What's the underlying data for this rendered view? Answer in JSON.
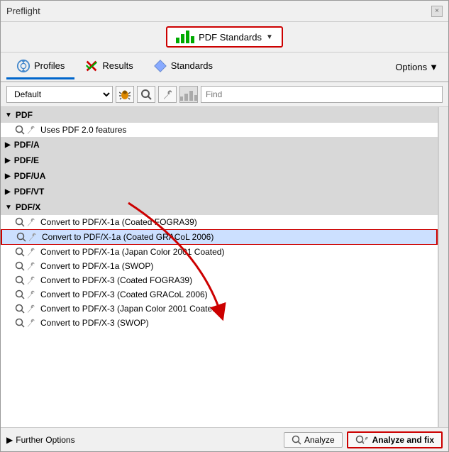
{
  "window": {
    "title": "Preflight",
    "close_label": "×"
  },
  "toolbar": {
    "pdf_standards_label": "PDF Standards",
    "dropdown_arrow": "▼"
  },
  "tabs": {
    "profiles_label": "Profiles",
    "results_label": "Results",
    "standards_label": "Standards",
    "options_label": "Options",
    "options_arrow": "▼"
  },
  "controls": {
    "dropdown_default": "Default",
    "find_placeholder": "Find"
  },
  "tree": {
    "groups": [
      {
        "id": "pdf",
        "label": "PDF",
        "expanded": true,
        "items": [
          {
            "label": "Uses PDF 2.0 features"
          }
        ]
      },
      {
        "id": "pdfa",
        "label": "PDF/A",
        "expanded": false,
        "items": []
      },
      {
        "id": "pdfe",
        "label": "PDF/E",
        "expanded": false,
        "items": []
      },
      {
        "id": "pdfua",
        "label": "PDF/UA",
        "expanded": false,
        "items": []
      },
      {
        "id": "pdfvt",
        "label": "PDF/VT",
        "expanded": false,
        "items": []
      },
      {
        "id": "pdfx",
        "label": "PDF/X",
        "expanded": true,
        "items": [
          {
            "label": "Convert to PDF/X-1a (Coated FOGRA39)",
            "selected": false
          },
          {
            "label": "Convert to PDF/X-1a (Coated GRACoL 2006)",
            "selected": true
          },
          {
            "label": "Convert to PDF/X-1a (Japan Color 2001 Coated)",
            "selected": false
          },
          {
            "label": "Convert to PDF/X-1a (SWOP)",
            "selected": false
          },
          {
            "label": "Convert to PDF/X-3 (Coated FOGRA39)",
            "selected": false
          },
          {
            "label": "Convert to PDF/X-3 (Coated GRACoL 2006)",
            "selected": false
          },
          {
            "label": "Convert to PDF/X-3 (Japan Color 2001 Coated)",
            "selected": false
          },
          {
            "label": "Convert to PDF/X-3 (SWOP)",
            "selected": false
          }
        ]
      }
    ]
  },
  "footer": {
    "further_options_label": "Further Options",
    "further_options_arrow": "▶",
    "analyze_label": "Analyze",
    "analyze_fix_label": "Analyze and fix"
  }
}
